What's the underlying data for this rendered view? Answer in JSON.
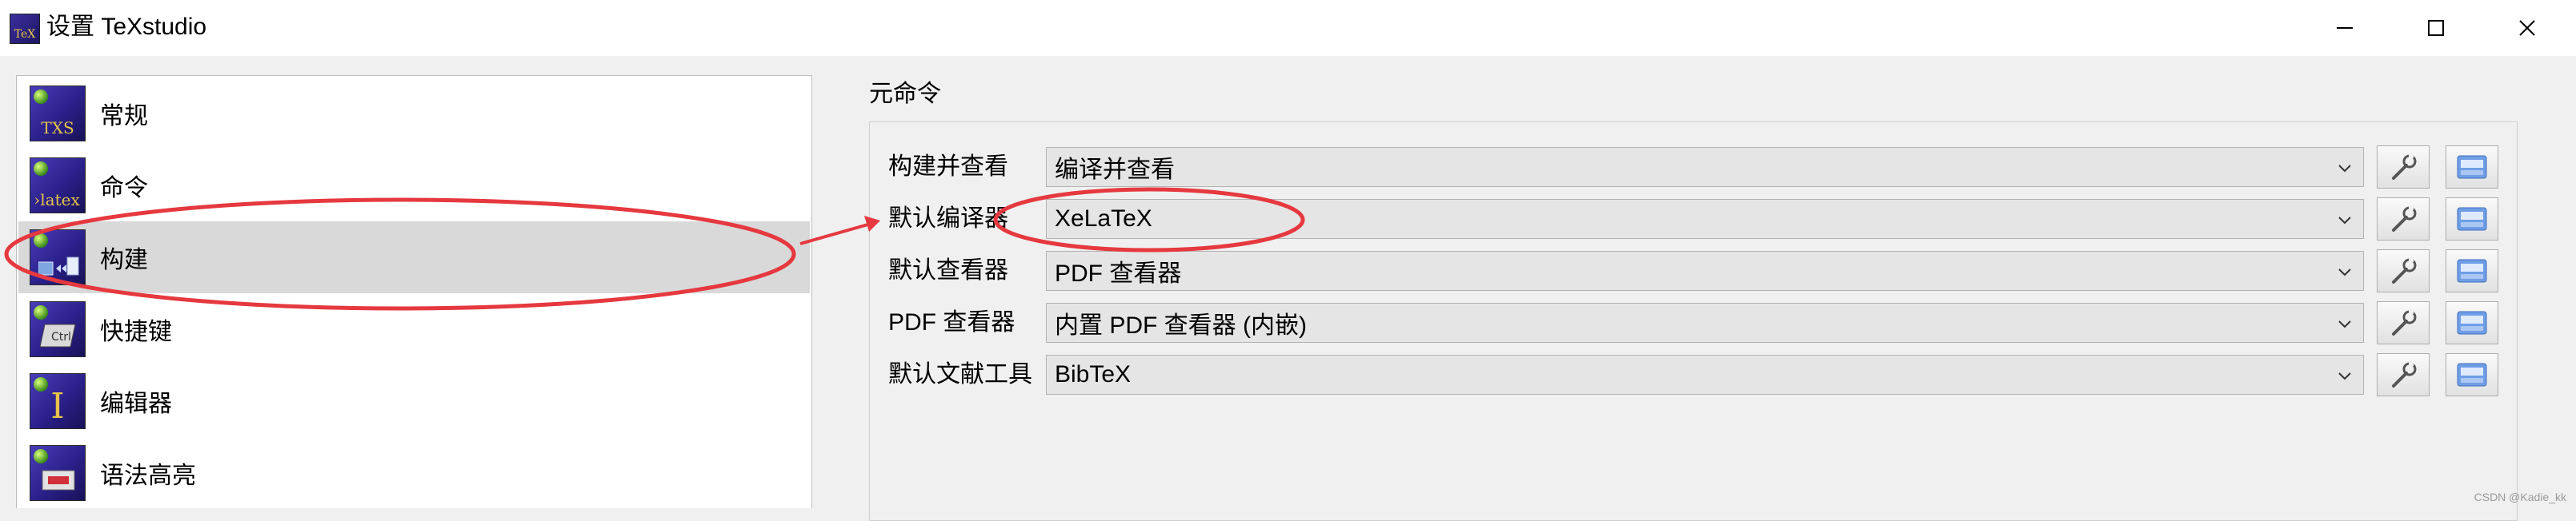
{
  "window": {
    "title": "设置 TeXstudio",
    "app_icon_text": "TeX",
    "controls": [
      "minimize",
      "maximize",
      "close"
    ]
  },
  "nav": {
    "items": [
      {
        "label": "常规",
        "icon": "txs-general-icon",
        "glyph": "TXS",
        "selected": false
      },
      {
        "label": "命令",
        "icon": "latex-command-icon",
        "glyph": "›latex",
        "selected": false
      },
      {
        "label": "构建",
        "icon": "build-icon",
        "glyph": "",
        "selected": true
      },
      {
        "label": "快捷键",
        "icon": "keyboard-shortcut-icon",
        "glyph": "",
        "selected": false
      },
      {
        "label": "编辑器",
        "icon": "editor-cursor-icon",
        "glyph": "I",
        "selected": false
      },
      {
        "label": "语法高亮",
        "icon": "syntax-highlight-icon",
        "glyph": "",
        "selected": false
      }
    ]
  },
  "meta_commands": {
    "group_title": "元命令",
    "rows": [
      {
        "label": "构建并查看",
        "value": "编译并查看"
      },
      {
        "label": "默认编译器",
        "value": "XeLaTeX"
      },
      {
        "label": "默认查看器",
        "value": "PDF 查看器"
      },
      {
        "label": "PDF 查看器",
        "value": "内置 PDF 查看器 (内嵌)"
      },
      {
        "label": "默认文献工具",
        "value": "BibTeX"
      }
    ]
  },
  "watermark": "CSDN @Kadie_kk",
  "colors": {
    "annotation_red": "#e5393f",
    "selected_row": "#d9d9d9",
    "icon_bg": "#2a208a"
  }
}
